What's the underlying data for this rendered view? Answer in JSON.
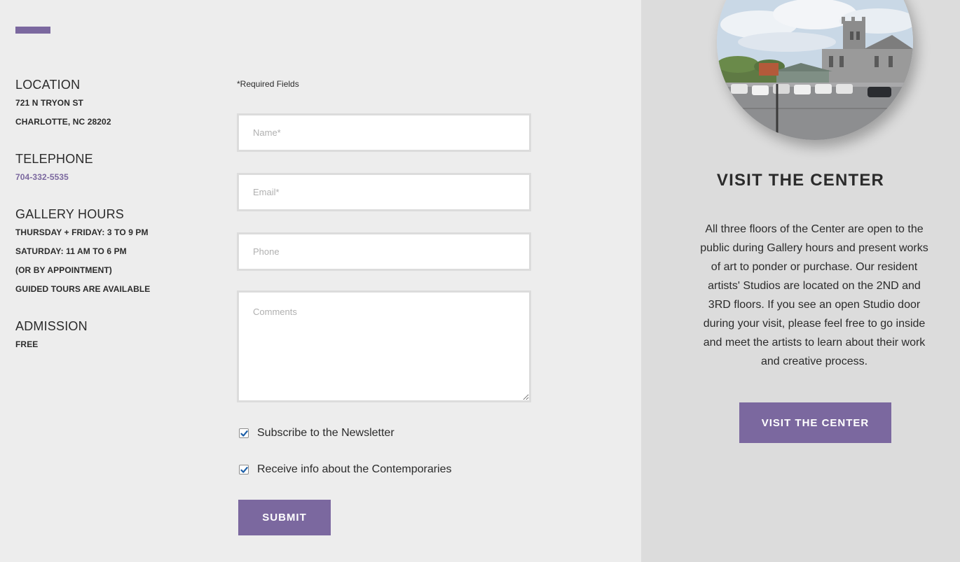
{
  "location": {
    "heading": "LOCATION",
    "lines": [
      "721 N TRYON ST",
      "CHARLOTTE, NC 28202"
    ]
  },
  "telephone": {
    "heading": "TELEPHONE",
    "number": "704-332-5535"
  },
  "gallery_hours": {
    "heading": "GALLERY HOURS",
    "lines": [
      "THURSDAY + FRIDAY: 3 TO 9 PM",
      "SATURDAY: 11 AM TO 6 PM",
      "(OR BY APPOINTMENT)",
      "GUIDED TOURS ARE AVAILABLE"
    ]
  },
  "admission": {
    "heading": "ADMISSION",
    "value": "FREE"
  },
  "form": {
    "required_note": "*Required Fields",
    "name_placeholder": "Name*",
    "email_placeholder": "Email*",
    "phone_placeholder": "Phone",
    "comments_placeholder": "Comments",
    "checkboxes": [
      {
        "label": "Subscribe to the Newsletter",
        "checked": true
      },
      {
        "label": "Receive info about the Contemporaries",
        "checked": true
      }
    ],
    "submit_label": "SUBMIT"
  },
  "side_panel": {
    "title": "VISIT THE CENTER",
    "body": "All three floors of the Center are open to the public during Gallery hours and present works of art to ponder or purchase. Our resident artists' Studios are located on the 2ND and 3RD floors. If you see an open Studio door during your visit, please feel free to go inside and meet the artists to learn about their work and creative process.",
    "button_label": "VISIT THE CENTER"
  },
  "colors": {
    "accent": "#7b689f",
    "page_bg": "#ededed",
    "panel_bg": "#dcdcdc",
    "text": "#2b2b2b",
    "checkbox_check": "#1d5fa8"
  },
  "icons": {
    "checkbox": "checkmark-icon"
  }
}
